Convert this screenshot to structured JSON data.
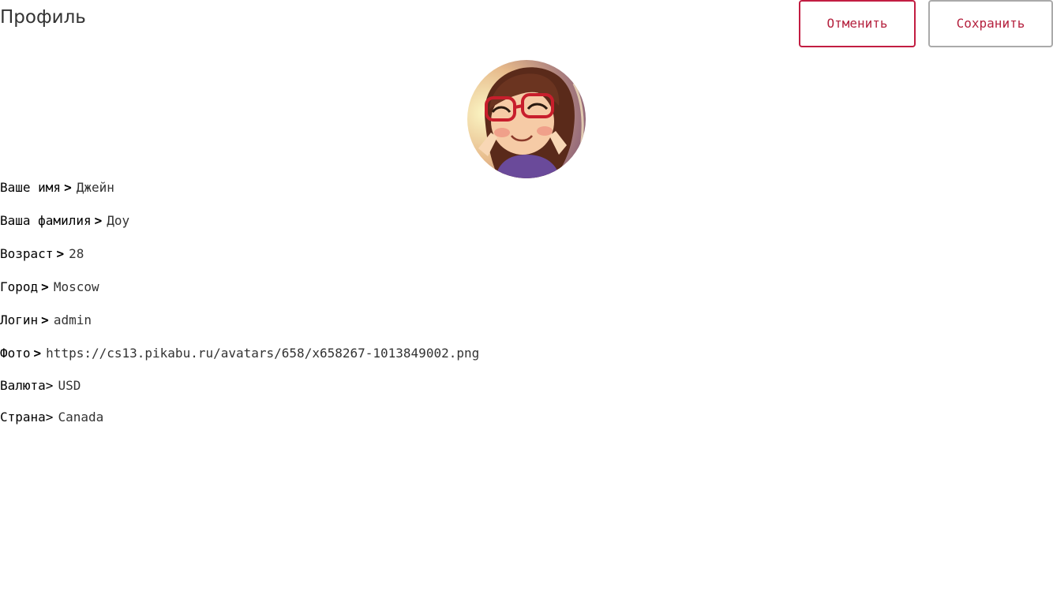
{
  "header": {
    "title": "Профиль",
    "cancel_label": "Отменить",
    "save_label": "Сохранить"
  },
  "colors": {
    "accent": "#c21d42",
    "accent_text": "#b5223f",
    "save_border": "#aaaaaa",
    "title_text": "#333333"
  },
  "fields": {
    "name": {
      "label": "Ваше имя",
      "sep": ">",
      "value": "Джейн"
    },
    "surname": {
      "label": "Ваша фамилия",
      "sep": ">",
      "value": "Доу"
    },
    "age": {
      "label": "Возраст",
      "sep": ">",
      "value": "28"
    },
    "city": {
      "label": "Город",
      "sep": ">",
      "value": "Moscow"
    },
    "login": {
      "label": "Логин",
      "sep": ">",
      "value": "admin"
    },
    "photo": {
      "label": "Фото",
      "sep": ">",
      "value": "https://cs13.pikabu.ru/avatars/658/x658267-1013849002.png"
    },
    "currency": {
      "label": "Валюта",
      "sep": ">",
      "value": "USD"
    },
    "country": {
      "label": "Страна",
      "sep": ">",
      "value": "Canada"
    }
  }
}
